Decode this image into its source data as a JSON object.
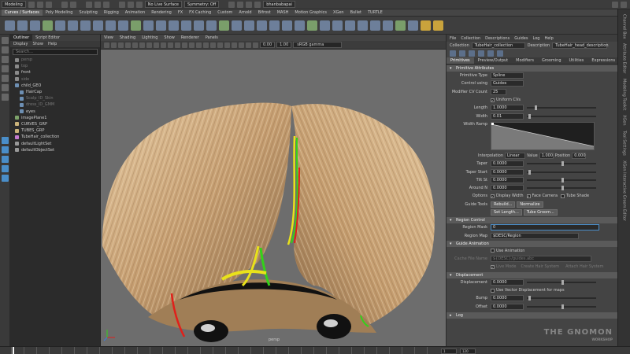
{
  "topbar": {
    "mode": "Modeling",
    "live_surface": "No Live Surface",
    "symmetry": "Symmetry: Off",
    "user": "bhanbabapai"
  },
  "shelf_tabs": [
    "Curves / Surfaces",
    "Poly Modeling",
    "Sculpting",
    "Rigging",
    "Animation",
    "Rendering",
    "FX",
    "FX Caching",
    "Custom",
    "Arnold",
    "Bifrost",
    "MASH",
    "Motion Graphics",
    "XGen",
    "Bullet",
    "TURTLE"
  ],
  "shelf_active_index": 0,
  "outliner": {
    "tabs": [
      "Outliner",
      "Script Editor"
    ],
    "menu": [
      "Display",
      "Show",
      "Help"
    ],
    "search_placeholder": "Search...",
    "items": [
      {
        "label": "persp",
        "dim": true,
        "indent": 1,
        "color": "#8a8a8a"
      },
      {
        "label": "top",
        "dim": true,
        "indent": 1,
        "color": "#8a8a8a"
      },
      {
        "label": "front",
        "dim": false,
        "indent": 1,
        "color": "#8a8a8a"
      },
      {
        "label": "side",
        "dim": true,
        "indent": 1,
        "color": "#8a8a8a"
      },
      {
        "label": "child_GEO",
        "dim": false,
        "indent": 1,
        "color": "#6d8fb3"
      },
      {
        "label": "HairCap",
        "dim": false,
        "indent": 2,
        "color": "#6d8fb3"
      },
      {
        "label": "Scalp_ID_Skin",
        "dim": true,
        "indent": 2,
        "color": "#6d8fb3"
      },
      {
        "label": "dress_ID_GMM",
        "dim": true,
        "indent": 2,
        "color": "#6d8fb3"
      },
      {
        "label": "eyes",
        "dim": false,
        "indent": 2,
        "color": "#6d8fb3"
      },
      {
        "label": "imagePlane1",
        "dim": false,
        "indent": 1,
        "color": "#7da36a"
      },
      {
        "label": "CURVES_GRP",
        "dim": false,
        "indent": 1,
        "color": "#c9b27a"
      },
      {
        "label": "TUBES_GRP",
        "dim": false,
        "indent": 1,
        "color": "#c9b27a"
      },
      {
        "label": "TubeHair_collection",
        "dim": false,
        "indent": 1,
        "color": "#c47ad0"
      },
      {
        "label": "defaultLightSet",
        "dim": false,
        "indent": 1,
        "color": "#999999"
      },
      {
        "label": "defaultObjectSet",
        "dim": false,
        "indent": 1,
        "color": "#999999"
      }
    ]
  },
  "viewport": {
    "menu": [
      "View",
      "Shading",
      "Lighting",
      "Show",
      "Renderer",
      "Panels"
    ],
    "exposure": "0.00",
    "gamma_value": "1.00",
    "color_space": "sRGB gamma",
    "camera_label": "persp"
  },
  "attr": {
    "menu": [
      "File",
      "Collection",
      "Descriptions",
      "Guides",
      "Log",
      "Help"
    ],
    "collection_label": "Collection",
    "collection_value": "TubeHair_collection",
    "description_label": "Description",
    "description_value": "TubeHair_head_description",
    "tabs": [
      "Primitives",
      "Preview/Output",
      "Modifiers",
      "Grooming",
      "Utilities",
      "Expressions"
    ],
    "sections": {
      "primitive_attributes": "Primitive Attributes",
      "region_control": "Region Control",
      "guide_animation": "Guide Animation",
      "displacement": "Displacement",
      "log": "Log"
    },
    "primitive_type_label": "Primitive Type",
    "primitive_type_value": "Spline",
    "control_using_label": "Control using",
    "control_using_value": "Guides",
    "modifier_cv_label": "Modifier CV Count",
    "modifier_cv_value": "25",
    "uniform_cvs": "Uniform CVs",
    "length_label": "Length",
    "length_value": "1.0000",
    "width_label": "Width",
    "width_value": "0.01",
    "width_ramp_label": "Width Ramp",
    "interpolation_label": "Interpolation",
    "interpolation_value": "Linear",
    "ramp_value_label": "Value",
    "ramp_value": "1.000",
    "ramp_position_label": "Position",
    "ramp_position": "0.000",
    "taper_label": "Taper",
    "taper_value": "0.0000",
    "taper_start_label": "Taper Start",
    "taper_start_value": "0.0000",
    "tilt_label": "Tilt St",
    "tilt_value": "0.0000",
    "around_label": "Around N",
    "around_value": "0.0000",
    "options_label": "Options",
    "display_width": "Display Width",
    "face_camera": "Face Camera",
    "tube_shade": "Tube Shade",
    "guide_tools_label": "Guide Tools",
    "rebuild_btn": "Rebuild...",
    "normalize_btn": "Normalize",
    "set_length_btn": "Set Length...",
    "tube_groom_btn": "Tube Groom...",
    "region_mask_label": "Region Mask",
    "region_mask_value": "0",
    "region_map_label": "Region Map",
    "region_map_value": "$DESC/Region",
    "use_animation": "Use Animation",
    "cache_file_label": "Cache File Name",
    "cache_file_value": "${DESC}/guides.abc",
    "live_mode": "Live Mode",
    "create_hair_system": "Create Hair System",
    "attach_hair_system": "Attach Hair System",
    "displacement_label": "Displacement",
    "displacement_value": "0.0000",
    "use_vector_disp": "Use Vector Displacement for maps",
    "bump_label": "Bump",
    "bump_value": "0.0000",
    "offset_label": "Offset",
    "offset_value": "0.0000"
  },
  "right_strip": [
    "Channel Box",
    "Attribute Editor",
    "Modeling Toolkit",
    "XGen",
    "Tool Settings",
    "XGen Interactive Groom Editor"
  ],
  "timeline": {
    "start": "1",
    "end": "120"
  },
  "watermark": {
    "line1": "THE GNOMON",
    "line2": "WORKSHOP"
  },
  "colors": {
    "accent": "#4a8ec9",
    "hair": "#c9a47a",
    "guide_green": "#33d11a",
    "guide_red": "#e0201a",
    "guide_yellow": "#e9e21a"
  }
}
